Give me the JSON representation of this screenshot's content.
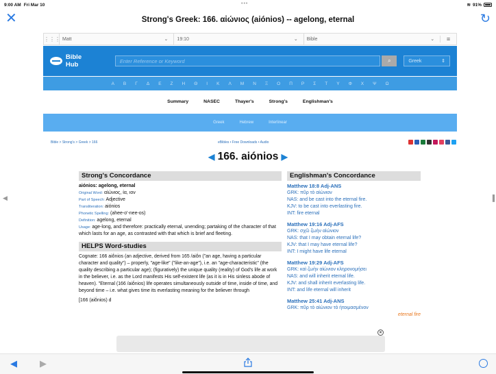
{
  "status": {
    "time": "9:00 AM",
    "date": "Fri Mar 10",
    "battery": "91%"
  },
  "nav": {
    "title": "Strong's Greek: 166. αἰώνιος (aiónios) -- agelong, eternal"
  },
  "selector": {
    "book": "Matt",
    "verse": "19:10",
    "version": "Bible"
  },
  "site": {
    "name": "Bible Hub",
    "search_placeholder": "Enter Reference or Keyword",
    "language": "Greek",
    "alphabet": [
      "Α",
      "Β",
      "Γ",
      "Δ",
      "Ε",
      "Ζ",
      "Η",
      "Θ",
      "Ι",
      "Κ",
      "Λ",
      "Μ",
      "Ν",
      "Ξ",
      "Ο",
      "Π",
      "Ρ",
      "Σ",
      "Τ",
      "Υ",
      "Φ",
      "Χ",
      "Ψ",
      "Ω"
    ],
    "tabs": [
      "Summary",
      "NASEC",
      "Thayer's",
      "Strong's",
      "Englishman's"
    ],
    "subtabs": [
      "Greek",
      "Hebrew",
      "Interlinear"
    ]
  },
  "crumbs": {
    "path": "Bible > Strong's > Greek > 166",
    "mid": "eBibles • Free Downloads • Audio"
  },
  "heading": "166. aiónios",
  "strongs": {
    "title": "Strong's Concordance",
    "word": "aiónios: agelong, eternal",
    "original_label": "Original Word:",
    "original": "αἰώνιος, ία, ιον",
    "pos_label": "Part of Speech:",
    "pos": "Adjective",
    "translit_label": "Transliteration:",
    "translit": "aiónios",
    "phon_label": "Phonetic Spelling:",
    "phon": "(ahee-o'-nee-os)",
    "def_label": "Definition:",
    "def": "agelong, eternal",
    "usage_label": "Usage:",
    "usage": "age-long, and therefore: practically eternal, unending; partaking of the character of that which lasts for an age, as contrasted with that which is brief and fleeting."
  },
  "helps": {
    "title": "HELPS Word-studies",
    "p1": "Cognate: 166 aiṓnios (an adjective, derived from 165 /aiṓn (\"an age, having a particular character and quality\") – properly, \"age-like\" (\"like-an-age\"), i.e. an \"age-characteristic\" (the quality describing a particular age); (figuratively) the unique quality (reality) of God's life at work in the believer, i.e. as the Lord manifests His self-existent life (as it is in His sinless abode of heaven). \"Eternal (166 /aiṓnios) life operates simultaneously outside of time, inside of time, and beyond time – i.e. what gives time its everlasting meaning for the believer through",
    "p2": "[166 (aiṓnios) d"
  },
  "englishman": {
    "title": "Englishman's Concordance",
    "entries": [
      {
        "ref": "Matthew 18:8 Adj-ANS",
        "grk": "GRK: πῦρ τὸ αἰώνιον",
        "nas": "NAS: and be cast into the eternal fire.",
        "kjv": "KJV: to be cast into everlasting fire.",
        "int": "INT: fire eternal"
      },
      {
        "ref": "Matthew 19:16 Adj-AFS",
        "grk": "GRK: σχῶ ζωὴν αἰώνιον",
        "nas": "NAS: that I may obtain eternal life?",
        "kjv": "KJV: that I may have eternal life?",
        "int": "INT: I might have life eternal"
      },
      {
        "ref": "Matthew 19:29 Adj-AFS",
        "grk": "GRK: καὶ ζωὴν αἰώνιον κληρονομήσει",
        "nas": "NAS: and will inherit eternal life.",
        "kjv": "KJV: and shall inherit everlasting life.",
        "int": "INT: and life eternal will inherit"
      },
      {
        "ref": "Matthew 25:41 Adj-ANS",
        "grk": "GRK: πῦρ τὸ αἰώνιον τὸ ἡτοιμασμένον",
        "nas": "",
        "kjv": "eternal fire",
        "int": ""
      }
    ]
  }
}
